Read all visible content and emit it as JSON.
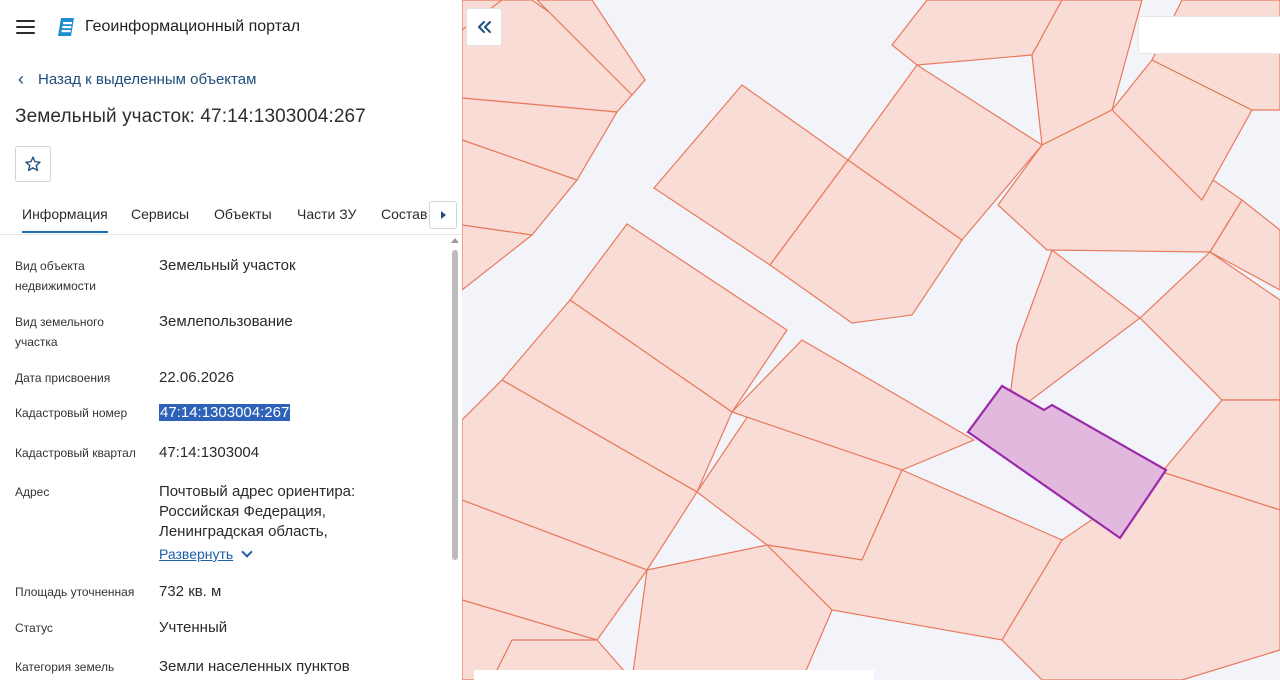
{
  "app": {
    "title": "Геоинформационный портал"
  },
  "nav": {
    "back_label": "Назад к выделенным объектам"
  },
  "object": {
    "title": "Земельный участок: 47:14:1303004:267"
  },
  "tabs": [
    {
      "label": "Информация",
      "active": true
    },
    {
      "label": "Сервисы",
      "active": false
    },
    {
      "label": "Объекты",
      "active": false
    },
    {
      "label": "Части ЗУ",
      "active": false
    },
    {
      "label": "Состав",
      "active": false
    }
  ],
  "properties": {
    "object_type": {
      "label": "Вид объекта недвижимости",
      "value": "Земельный участок"
    },
    "land_type": {
      "label": "Вид земельного участка",
      "value": "Землепользование"
    },
    "assign_date": {
      "label": "Дата присвоения",
      "value": "22.06.2026"
    },
    "cadastral_number": {
      "label": "Кадастровый номер",
      "value": "47:14:1303004:267"
    },
    "cadastral_quarter": {
      "label": "Кадастровый квартал",
      "value": "47:14:1303004"
    },
    "address": {
      "label": "Адрес",
      "line1": "Почтовый адрес ориентира:",
      "line2": "Российская Федерация,",
      "line3": "Ленинградская область,",
      "expand_label": "Развернуть"
    },
    "area": {
      "label": "Площадь уточненная",
      "value": "732 кв. м"
    },
    "status": {
      "label": "Статус",
      "value": "Учтенный"
    },
    "category": {
      "label": "Категория земель",
      "value": "Земли населенных пунктов"
    }
  },
  "map": {
    "parcel_fill": "#f9dcd6",
    "parcel_stroke": "#e87a5c",
    "selected_fill": "#e3b8de",
    "selected_stroke": "#9b2aa8",
    "background": "#f3f3fa"
  },
  "icons": {
    "menu": "hamburger-icon",
    "logo": "portal-logo-icon",
    "back": "chevron-left-icon",
    "favorite": "star-outline-icon",
    "tab_next": "triangle-right-icon",
    "collapse": "double-chevron-left-icon",
    "expand": "chevron-down-icon"
  }
}
